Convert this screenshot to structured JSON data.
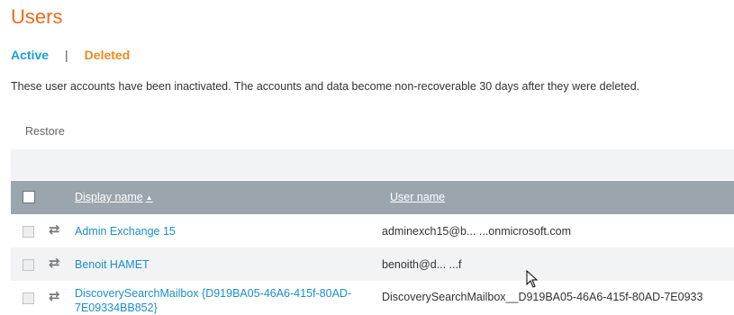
{
  "page": {
    "title": "Users",
    "description": "These user accounts have been inactivated. The accounts and data become non-recoverable 30 days after they were deleted."
  },
  "tabs": {
    "active": "Active",
    "separator": "|",
    "deleted": "Deleted"
  },
  "toolbar": {
    "restore_label": "Restore"
  },
  "grid": {
    "columns": {
      "display_name": "Display name",
      "sort_indicator": "▲",
      "user_name": "User name"
    },
    "rows": [
      {
        "display_name": "Admin Exchange 15",
        "user_name": "adminexch15@b... ...onmicrosoft.com"
      },
      {
        "display_name": "Benoit HAMET",
        "user_name": "benoith@d... ...f"
      },
      {
        "display_name": "DiscoverySearchMailbox {D919BA05-46A6-415f-80AD-7E09334BB852}",
        "user_name": "DiscoverySearchMailbox__D919BA05-46A6-415f-80AD-7E0933"
      }
    ]
  },
  "colors": {
    "title": "#eb6b1d",
    "tab_active": "#1aa0d8",
    "tab_deleted": "#eb8a1d",
    "header_bg": "#9aa5ad",
    "link": "#1a8fc9"
  },
  "icons": {
    "row_status": "refresh-icon",
    "pointer": "mouse-pointer-icon"
  }
}
